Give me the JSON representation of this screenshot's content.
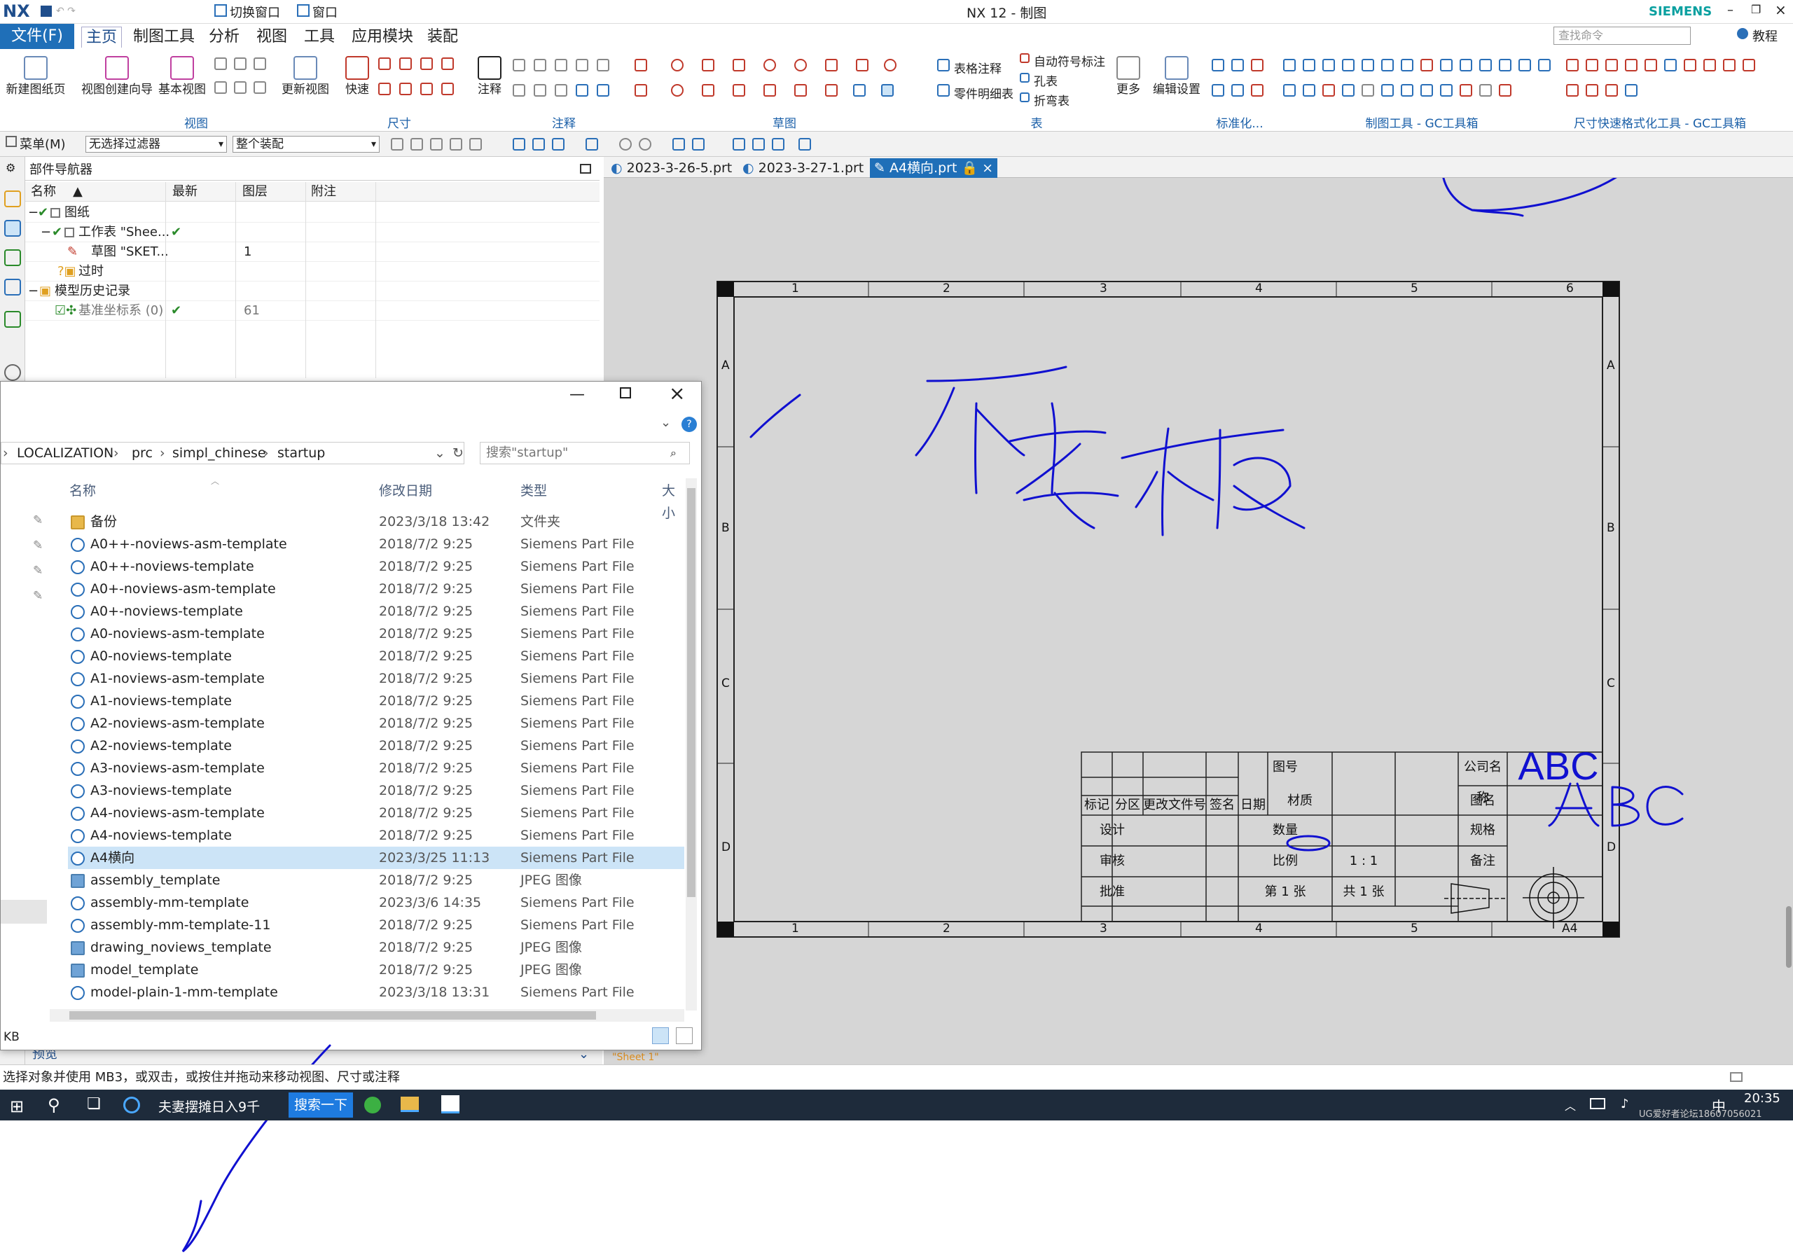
{
  "app": {
    "logo": "NX",
    "title": "NX 12 - 制图",
    "brand": "SIEMENS",
    "quick_switch_window": "切换窗口",
    "quick_window": "窗口"
  },
  "menubar": {
    "file": "文件(F)",
    "items": [
      "主页",
      "制图工具",
      "分析",
      "视图",
      "工具",
      "应用模块",
      "装配"
    ],
    "search_placeholder": "查找命令",
    "help_label": "教程"
  },
  "ribbon": {
    "buttons": {
      "new_sheet": "新建图纸页",
      "view_wizard": "视图创建向导",
      "base_view": "基本视图",
      "update_views": "更新视图",
      "quick_dim": "快速",
      "note": "注释",
      "more": "更多",
      "edit_settings": "编辑设置",
      "table_note": "表格注释",
      "parts_list": "零件明细表",
      "auto_balloon": "自动符号标注",
      "hole_table": "孔表",
      "bend_table": "折弯表"
    },
    "groups": {
      "view": "视图",
      "dimension": "尺寸",
      "annotation": "注释",
      "sketch": "草图",
      "table": "表",
      "standard": "标准化...",
      "gc_toolbox": "制图工具 - GC工具箱",
      "quick_format": "尺寸快速格式化工具 - GC工具箱"
    }
  },
  "cmdbar": {
    "menu": "菜单(M)",
    "filter": "无选择过滤器",
    "scope": "整个装配"
  },
  "tabs": [
    "2023-3-26-5.prt",
    "2023-3-27-1.prt",
    "A4横向.prt"
  ],
  "part_nav": {
    "title": "部件导航器",
    "columns": [
      "名称",
      "最新",
      "图层",
      "附注"
    ],
    "rows": [
      {
        "name": "图纸",
        "latest": "✔",
        "layer": ""
      },
      {
        "name": "工作表 \"Shee...",
        "latest": "✔",
        "layer": ""
      },
      {
        "name": "草图 \"SKET...",
        "latest": "",
        "layer": "1"
      },
      {
        "name": "过时",
        "latest": "",
        "layer": ""
      },
      {
        "name": "模型历史记录",
        "latest": "",
        "layer": ""
      },
      {
        "name": "基准坐标系 (0)",
        "latest": "✔",
        "layer": "61"
      }
    ],
    "preview_label": "预览"
  },
  "explorer": {
    "breadcrumb": [
      "LOCALIZATION",
      "prc",
      "simpl_chinese",
      "startup"
    ],
    "search_placeholder": "搜索\"startup\"",
    "columns": [
      "名称",
      "修改日期",
      "类型",
      "大小"
    ],
    "files": [
      {
        "name": "备份",
        "date": "2023/3/18 13:42",
        "type": "文件夹",
        "kind": "folder"
      },
      {
        "name": "A0++-noviews-asm-template",
        "date": "2018/7/2 9:25",
        "type": "Siemens Part File",
        "kind": "prt"
      },
      {
        "name": "A0++-noviews-template",
        "date": "2018/7/2 9:25",
        "type": "Siemens Part File",
        "kind": "prt"
      },
      {
        "name": "A0+-noviews-asm-template",
        "date": "2018/7/2 9:25",
        "type": "Siemens Part File",
        "kind": "prt"
      },
      {
        "name": "A0+-noviews-template",
        "date": "2018/7/2 9:25",
        "type": "Siemens Part File",
        "kind": "prt"
      },
      {
        "name": "A0-noviews-asm-template",
        "date": "2018/7/2 9:25",
        "type": "Siemens Part File",
        "kind": "prt"
      },
      {
        "name": "A0-noviews-template",
        "date": "2018/7/2 9:25",
        "type": "Siemens Part File",
        "kind": "prt"
      },
      {
        "name": "A1-noviews-asm-template",
        "date": "2018/7/2 9:25",
        "type": "Siemens Part File",
        "kind": "prt"
      },
      {
        "name": "A1-noviews-template",
        "date": "2018/7/2 9:25",
        "type": "Siemens Part File",
        "kind": "prt"
      },
      {
        "name": "A2-noviews-asm-template",
        "date": "2018/7/2 9:25",
        "type": "Siemens Part File",
        "kind": "prt"
      },
      {
        "name": "A2-noviews-template",
        "date": "2018/7/2 9:25",
        "type": "Siemens Part File",
        "kind": "prt"
      },
      {
        "name": "A3-noviews-asm-template",
        "date": "2018/7/2 9:25",
        "type": "Siemens Part File",
        "kind": "prt"
      },
      {
        "name": "A3-noviews-template",
        "date": "2018/7/2 9:25",
        "type": "Siemens Part File",
        "kind": "prt"
      },
      {
        "name": "A4-noviews-asm-template",
        "date": "2018/7/2 9:25",
        "type": "Siemens Part File",
        "kind": "prt"
      },
      {
        "name": "A4-noviews-template",
        "date": "2018/7/2 9:25",
        "type": "Siemens Part File",
        "kind": "prt"
      },
      {
        "name": "A4横向",
        "date": "2023/3/25 11:13",
        "type": "Siemens Part File",
        "kind": "prt",
        "selected": true
      },
      {
        "name": "assembly_template",
        "date": "2018/7/2 9:25",
        "type": "JPEG 图像",
        "kind": "jpg"
      },
      {
        "name": "assembly-mm-template",
        "date": "2023/3/6 14:35",
        "type": "Siemens Part File",
        "kind": "prt"
      },
      {
        "name": "assembly-mm-template-11",
        "date": "2018/7/2 9:25",
        "type": "Siemens Part File",
        "kind": "prt"
      },
      {
        "name": "drawing_noviews_template",
        "date": "2018/7/2 9:25",
        "type": "JPEG 图像",
        "kind": "jpg"
      },
      {
        "name": "model_template",
        "date": "2018/7/2 9:25",
        "type": "JPEG 图像",
        "kind": "jpg"
      },
      {
        "name": "model-plain-1-mm-template",
        "date": "2023/3/18 13:31",
        "type": "Siemens Part File",
        "kind": "prt"
      }
    ],
    "size_label": "KB"
  },
  "drawing": {
    "zones_top": [
      "1",
      "2",
      "3",
      "4",
      "5",
      "6"
    ],
    "zones_bottom": [
      "1",
      "2",
      "3",
      "4",
      "5",
      "A4"
    ],
    "zones_side": [
      "A",
      "B",
      "C",
      "D"
    ],
    "handwriting": "模板",
    "title_block": {
      "mark": "标记",
      "zone": "分区",
      "change_doc": "更改文件号",
      "sign": "签名",
      "date": "日期",
      "design": "设计",
      "review": "审核",
      "approve": "批准",
      "drawing_no": "图号",
      "material": "材质",
      "quantity": "数量",
      "scale": "比例",
      "scale_value": "1 : 1",
      "sheet": "第 1 张",
      "total": "共 1 张",
      "company": "公司名称",
      "company_value": "ABC",
      "drawing_name": "图名",
      "spec": "规格",
      "remark": "备注"
    },
    "sheet_tab": "\"Sheet 1\""
  },
  "status": {
    "message": "选择对象并使用 MB3，或双击，或按住并拖动来移动视图、尺寸或注释"
  },
  "taskbar": {
    "browser_label": "夫妻摆摊日入9千",
    "search_button": "搜索一下",
    "ime": "中",
    "time": "20:35",
    "watermark": "UG爱好者论坛18607056021"
  }
}
